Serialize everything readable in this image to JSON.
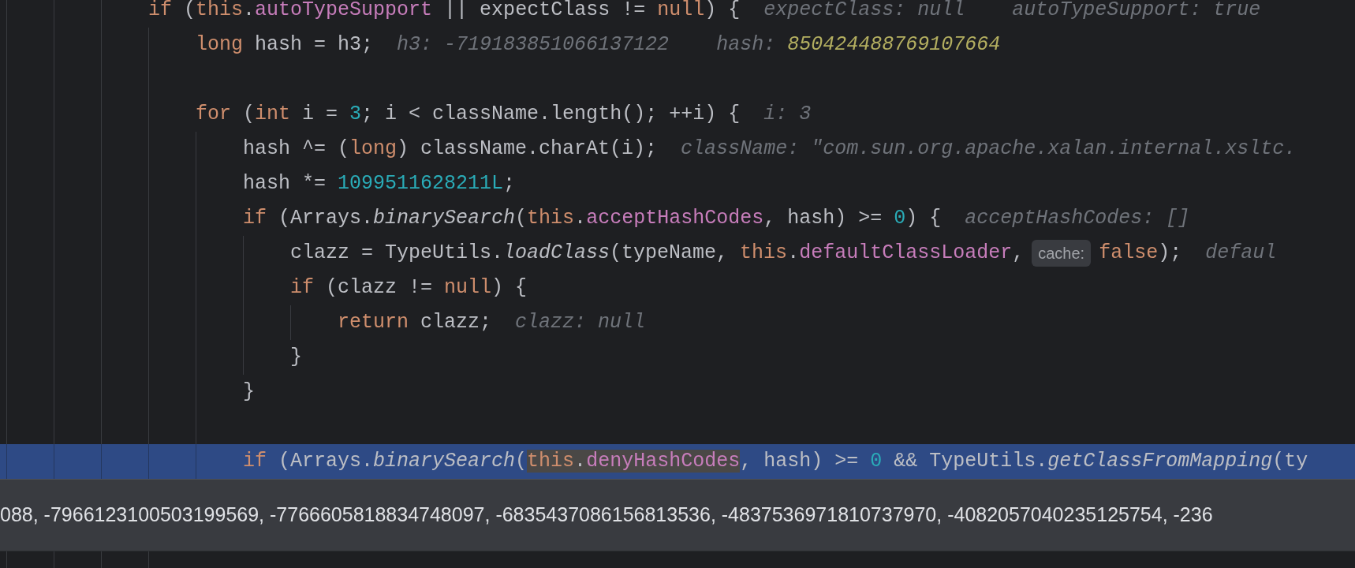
{
  "lines": [
    {
      "kind": "code",
      "current": false,
      "segments": [
        {
          "kind": "code",
          "tokens": [
            {
              "kind": "keyword",
              "text": "if"
            },
            {
              "kind": "plain",
              "text": " ("
            },
            {
              "kind": "keyword",
              "text": "this"
            },
            {
              "kind": "plain",
              "text": "."
            },
            {
              "kind": "field",
              "text": "autoTypeSupport"
            },
            {
              "kind": "plain",
              "text": " || expectClass != "
            },
            {
              "kind": "keyword",
              "text": "null"
            },
            {
              "kind": "plain",
              "text": ") {"
            }
          ]
        },
        {
          "kind": "hint",
          "label": "expectClass:",
          "value": "null",
          "changed": false
        },
        {
          "kind": "hint",
          "label": "autoTypeSupport:",
          "value": "true",
          "changed": false
        }
      ],
      "children": [
        {
          "kind": "code",
          "current": false,
          "segments": [
            {
              "kind": "code",
              "tokens": [
                {
                  "kind": "keyword",
                  "text": "long"
                },
                {
                  "kind": "plain",
                  "text": " hash = h3;"
                }
              ]
            },
            {
              "kind": "hint",
              "label": "h3:",
              "value": "-719183851066137122",
              "changed": false
            },
            {
              "kind": "hint",
              "label": "hash:",
              "value": "850424488769107664",
              "changed": true
            }
          ]
        },
        {
          "kind": "blank"
        },
        {
          "kind": "code",
          "current": false,
          "segments": [
            {
              "kind": "code",
              "tokens": [
                {
                  "kind": "keyword",
                  "text": "for"
                },
                {
                  "kind": "plain",
                  "text": " ("
                },
                {
                  "kind": "keyword",
                  "text": "int"
                },
                {
                  "kind": "plain",
                  "text": " i = "
                },
                {
                  "kind": "number",
                  "text": "3"
                },
                {
                  "kind": "plain",
                  "text": "; i < className.length(); ++i) {"
                }
              ]
            },
            {
              "kind": "hint",
              "label": "i:",
              "value": "3",
              "changed": false
            }
          ],
          "children": [
            {
              "kind": "code",
              "current": false,
              "segments": [
                {
                  "kind": "code",
                  "tokens": [
                    {
                      "kind": "plain",
                      "text": "hash ^= ("
                    },
                    {
                      "kind": "keyword",
                      "text": "long"
                    },
                    {
                      "kind": "plain",
                      "text": ") className.charAt(i);"
                    }
                  ]
                },
                {
                  "kind": "hint",
                  "label": "className:",
                  "value": "\"com.sun.org.apache.xalan.internal.xsltc.",
                  "changed": false
                }
              ]
            },
            {
              "kind": "code",
              "current": false,
              "segments": [
                {
                  "kind": "code",
                  "tokens": [
                    {
                      "kind": "plain",
                      "text": "hash *= "
                    },
                    {
                      "kind": "number",
                      "text": "1099511628211L"
                    },
                    {
                      "kind": "plain",
                      "text": ";"
                    }
                  ]
                }
              ]
            },
            {
              "kind": "code",
              "current": false,
              "segments": [
                {
                  "kind": "code",
                  "tokens": [
                    {
                      "kind": "keyword",
                      "text": "if"
                    },
                    {
                      "kind": "plain",
                      "text": " (Arrays."
                    },
                    {
                      "kind": "method",
                      "text": "binarySearch"
                    },
                    {
                      "kind": "plain",
                      "text": "("
                    },
                    {
                      "kind": "keyword",
                      "text": "this"
                    },
                    {
                      "kind": "plain",
                      "text": "."
                    },
                    {
                      "kind": "field",
                      "text": "acceptHashCodes"
                    },
                    {
                      "kind": "plain",
                      "text": ", hash) >= "
                    },
                    {
                      "kind": "number",
                      "text": "0"
                    },
                    {
                      "kind": "plain",
                      "text": ") {"
                    }
                  ]
                },
                {
                  "kind": "hint",
                  "label": "acceptHashCodes:",
                  "value": "[]",
                  "changed": false
                }
              ],
              "children": [
                {
                  "kind": "code",
                  "current": false,
                  "segments": [
                    {
                      "kind": "code",
                      "tokens": [
                        {
                          "kind": "plain",
                          "text": "clazz = TypeUtils."
                        },
                        {
                          "kind": "method",
                          "text": "loadClass"
                        },
                        {
                          "kind": "plain",
                          "text": "(typeName, "
                        },
                        {
                          "kind": "keyword",
                          "text": "this"
                        },
                        {
                          "kind": "plain",
                          "text": "."
                        },
                        {
                          "kind": "field",
                          "text": "defaultClassLoader"
                        },
                        {
                          "kind": "plain",
                          "text": ","
                        }
                      ]
                    },
                    {
                      "kind": "param_hint",
                      "text": "cache:"
                    },
                    {
                      "kind": "code",
                      "tokens": [
                        {
                          "kind": "keyword",
                          "text": "false"
                        },
                        {
                          "kind": "plain",
                          "text": ");"
                        }
                      ]
                    },
                    {
                      "kind": "hint",
                      "label": "defaul"
                    }
                  ]
                },
                {
                  "kind": "code",
                  "current": false,
                  "segments": [
                    {
                      "kind": "code",
                      "tokens": [
                        {
                          "kind": "keyword",
                          "text": "if"
                        },
                        {
                          "kind": "plain",
                          "text": " (clazz != "
                        },
                        {
                          "kind": "keyword",
                          "text": "null"
                        },
                        {
                          "kind": "plain",
                          "text": ") {"
                        }
                      ]
                    }
                  ],
                  "children": [
                    {
                      "kind": "code",
                      "current": false,
                      "segments": [
                        {
                          "kind": "code",
                          "tokens": [
                            {
                              "kind": "keyword",
                              "text": "return"
                            },
                            {
                              "kind": "plain",
                              "text": " clazz;"
                            }
                          ]
                        },
                        {
                          "kind": "hint",
                          "label": "clazz:",
                          "value": "null",
                          "changed": false
                        }
                      ]
                    }
                  ]
                },
                {
                  "kind": "code",
                  "current": false,
                  "segments": [
                    {
                      "kind": "code",
                      "tokens": [
                        {
                          "kind": "plain",
                          "text": "}"
                        }
                      ]
                    }
                  ]
                }
              ]
            },
            {
              "kind": "code",
              "current": false,
              "segments": [
                {
                  "kind": "code",
                  "tokens": [
                    {
                      "kind": "plain",
                      "text": "}"
                    }
                  ]
                }
              ]
            },
            {
              "kind": "blank"
            },
            {
              "kind": "code",
              "current": true,
              "segments": [
                {
                  "kind": "code",
                  "tokens": [
                    {
                      "kind": "keyword",
                      "text": "if"
                    },
                    {
                      "kind": "plain",
                      "text": " (Arrays."
                    },
                    {
                      "kind": "method",
                      "text": "binarySearch"
                    },
                    {
                      "kind": "plain",
                      "text": "("
                    },
                    {
                      "kind": "keyword",
                      "text": "this",
                      "usage": true
                    },
                    {
                      "kind": "plain",
                      "text": ".",
                      "usage": true
                    },
                    {
                      "kind": "field",
                      "text": "denyHashCodes",
                      "usage": true
                    },
                    {
                      "kind": "plain",
                      "text": ", hash) >= "
                    },
                    {
                      "kind": "number",
                      "text": "0"
                    },
                    {
                      "kind": "plain",
                      "text": " && TypeUtils."
                    },
                    {
                      "kind": "method",
                      "text": "getClassFromMapping"
                    },
                    {
                      "kind": "plain",
                      "text": "(ty"
                    }
                  ]
                }
              ]
            }
          ]
        }
      ]
    }
  ],
  "value_popup": {
    "text": "088, -7966123100503199569, -7766605818834748097, -6835437086156813536, -4837536971810737970, -4082057040235125754, -236"
  }
}
